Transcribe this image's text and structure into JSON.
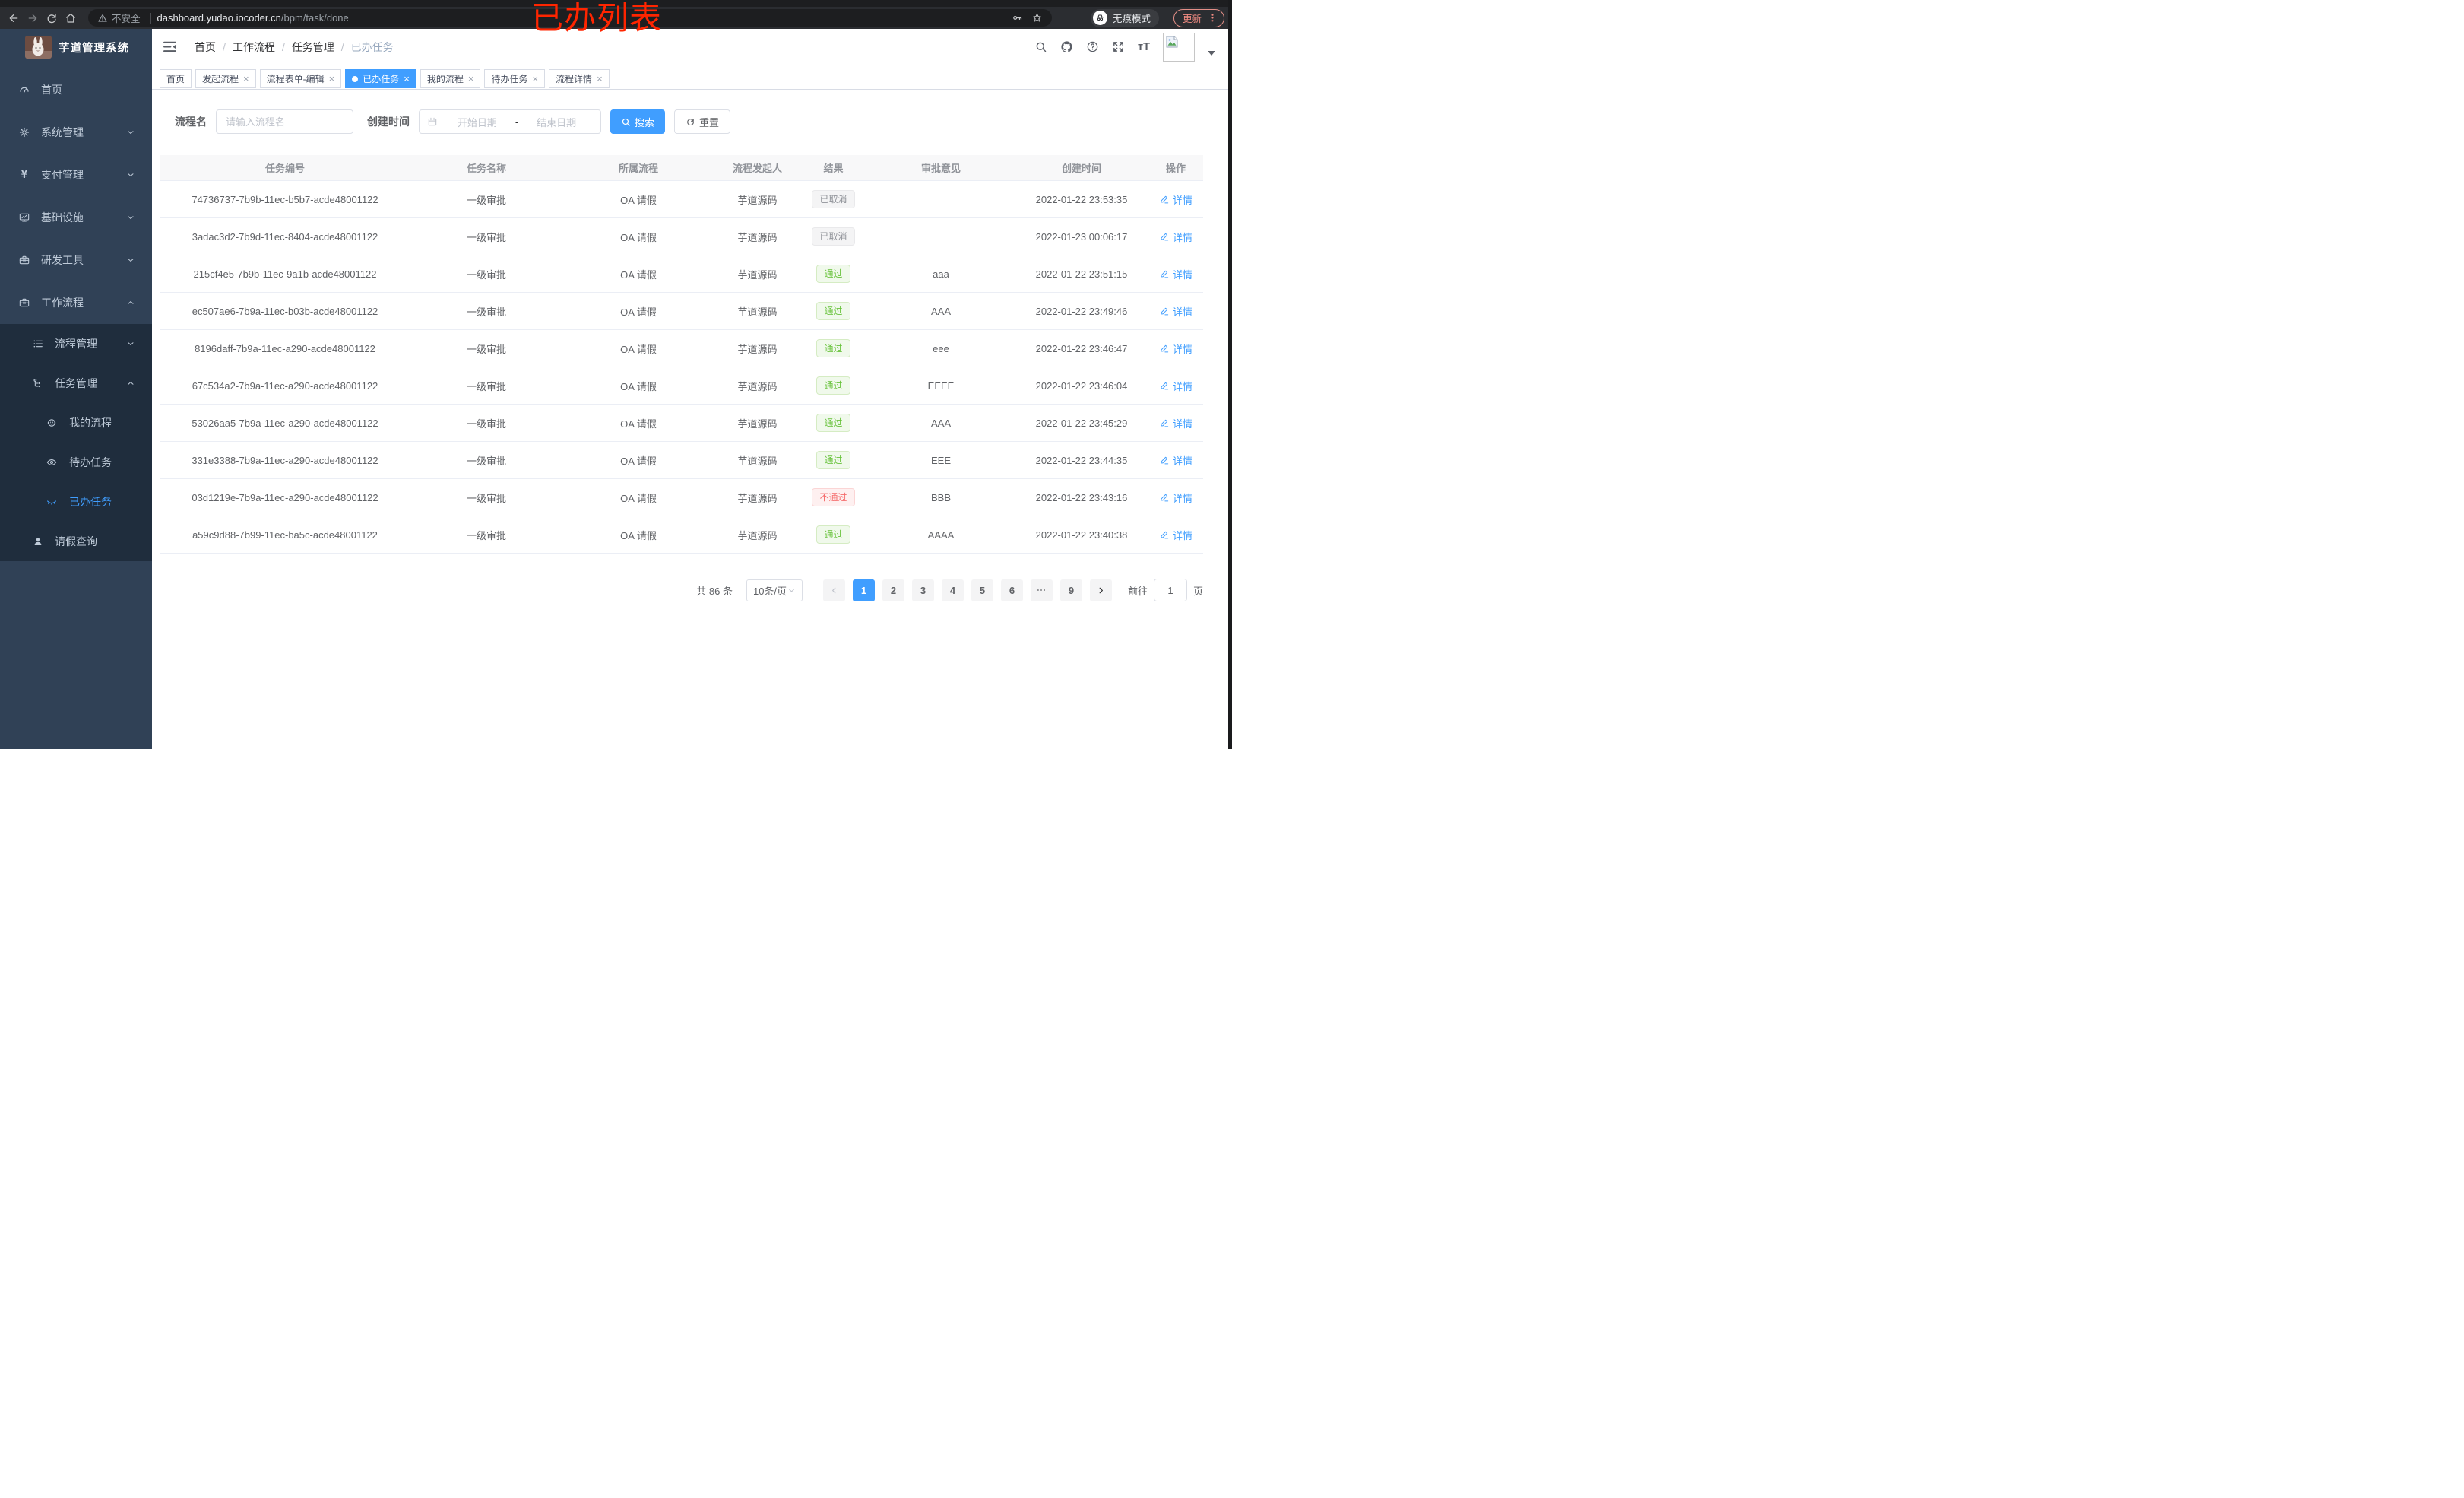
{
  "annotation": {
    "text": "已办列表",
    "color": "#ff2500"
  },
  "browser": {
    "security_label": "不安全",
    "url_domain": "dashboard.yudao.iocoder.cn",
    "url_path": "/bpm/task/done",
    "incognito_label": "无痕模式",
    "update_label": "更新"
  },
  "sidebar": {
    "logo_title": "芋道管理系统",
    "menu": [
      {
        "id": "home",
        "label": "首页",
        "icon": "dashboard-icon",
        "level": 1
      },
      {
        "id": "system",
        "label": "系统管理",
        "icon": "gear-icon",
        "level": 1,
        "arrow": "down"
      },
      {
        "id": "payment",
        "label": "支付管理",
        "icon": "yen-icon",
        "level": 1,
        "arrow": "down"
      },
      {
        "id": "infra",
        "label": "基础设施",
        "icon": "monitor-icon",
        "level": 1,
        "arrow": "down"
      },
      {
        "id": "devtools",
        "label": "研发工具",
        "icon": "toolbox-icon",
        "level": 1,
        "arrow": "down"
      },
      {
        "id": "workflow",
        "label": "工作流程",
        "icon": "briefcase-icon",
        "level": 1,
        "arrow": "up"
      },
      {
        "id": "process-mgmt",
        "label": "流程管理",
        "icon": "list-icon",
        "level": 2,
        "sub": true,
        "arrow": "down"
      },
      {
        "id": "task-mgmt",
        "label": "任务管理",
        "icon": "tree-icon",
        "level": 2,
        "sub": true,
        "arrow": "up"
      },
      {
        "id": "my-process",
        "label": "我的流程",
        "icon": "robot-icon",
        "level": 3,
        "sub": true
      },
      {
        "id": "todo-tasks",
        "label": "待办任务",
        "icon": "eye-open-icon",
        "level": 3,
        "sub": true
      },
      {
        "id": "done-tasks",
        "label": "已办任务",
        "icon": "eye-closed-icon",
        "level": 3,
        "sub": true,
        "active": true
      },
      {
        "id": "leave-query",
        "label": "请假查询",
        "icon": "user-icon",
        "level": 2,
        "sub": true
      }
    ]
  },
  "breadcrumb": {
    "items": [
      "首页",
      "工作流程",
      "任务管理",
      "已办任务"
    ]
  },
  "tabs": [
    {
      "id": "home",
      "label": "首页"
    },
    {
      "id": "start-process",
      "label": "发起流程",
      "closable": true
    },
    {
      "id": "form-editor",
      "label": "流程表单-编辑",
      "closable": true
    },
    {
      "id": "done-tasks",
      "label": "已办任务",
      "closable": true,
      "active": true
    },
    {
      "id": "my-process",
      "label": "我的流程",
      "closable": true
    },
    {
      "id": "todo-tasks",
      "label": "待办任务",
      "closable": true
    },
    {
      "id": "process-detail",
      "label": "流程详情",
      "closable": true
    }
  ],
  "filters": {
    "name_label": "流程名",
    "name_placeholder": "请输入流程名",
    "date_label": "创建时间",
    "date_start_placeholder": "开始日期",
    "date_separator": "-",
    "date_end_placeholder": "结束日期",
    "search_label": "搜索",
    "reset_label": "重置"
  },
  "table": {
    "columns": [
      "任务编号",
      "任务名称",
      "所属流程",
      "流程发起人",
      "结果",
      "审批意见",
      "创建时间",
      "操作"
    ],
    "action_label": "详情",
    "rows": [
      {
        "id": "74736737-7b9b-11ec-b5b7-acde48001122",
        "name": "一级审批",
        "process": "OA 请假",
        "starter": "芋道源码",
        "result": {
          "text": "已取消",
          "type": "info"
        },
        "comment": "",
        "created": "2022-01-22 23:53:35"
      },
      {
        "id": "3adac3d2-7b9d-11ec-8404-acde48001122",
        "name": "一级审批",
        "process": "OA 请假",
        "starter": "芋道源码",
        "result": {
          "text": "已取消",
          "type": "info"
        },
        "comment": "",
        "created": "2022-01-23 00:06:17"
      },
      {
        "id": "215cf4e5-7b9b-11ec-9a1b-acde48001122",
        "name": "一级审批",
        "process": "OA 请假",
        "starter": "芋道源码",
        "result": {
          "text": "通过",
          "type": "success"
        },
        "comment": "aaa",
        "created": "2022-01-22 23:51:15"
      },
      {
        "id": "ec507ae6-7b9a-11ec-b03b-acde48001122",
        "name": "一级审批",
        "process": "OA 请假",
        "starter": "芋道源码",
        "result": {
          "text": "通过",
          "type": "success"
        },
        "comment": "AAA",
        "created": "2022-01-22 23:49:46"
      },
      {
        "id": "8196daff-7b9a-11ec-a290-acde48001122",
        "name": "一级审批",
        "process": "OA 请假",
        "starter": "芋道源码",
        "result": {
          "text": "通过",
          "type": "success"
        },
        "comment": "eee",
        "created": "2022-01-22 23:46:47"
      },
      {
        "id": "67c534a2-7b9a-11ec-a290-acde48001122",
        "name": "一级审批",
        "process": "OA 请假",
        "starter": "芋道源码",
        "result": {
          "text": "通过",
          "type": "success"
        },
        "comment": "EEEE",
        "created": "2022-01-22 23:46:04"
      },
      {
        "id": "53026aa5-7b9a-11ec-a290-acde48001122",
        "name": "一级审批",
        "process": "OA 请假",
        "starter": "芋道源码",
        "result": {
          "text": "通过",
          "type": "success"
        },
        "comment": "AAA",
        "created": "2022-01-22 23:45:29"
      },
      {
        "id": "331e3388-7b9a-11ec-a290-acde48001122",
        "name": "一级审批",
        "process": "OA 请假",
        "starter": "芋道源码",
        "result": {
          "text": "通过",
          "type": "success"
        },
        "comment": "EEE",
        "created": "2022-01-22 23:44:35"
      },
      {
        "id": "03d1219e-7b9a-11ec-a290-acde48001122",
        "name": "一级审批",
        "process": "OA 请假",
        "starter": "芋道源码",
        "result": {
          "text": "不通过",
          "type": "danger"
        },
        "comment": "BBB",
        "created": "2022-01-22 23:43:16"
      },
      {
        "id": "a59c9d88-7b99-11ec-ba5c-acde48001122",
        "name": "一级审批",
        "process": "OA 请假",
        "starter": "芋道源码",
        "result": {
          "text": "通过",
          "type": "success"
        },
        "comment": "AAAA",
        "created": "2022-01-22 23:40:38"
      }
    ]
  },
  "pagination": {
    "total_label": "共 86 条",
    "page_size": "10条/页",
    "pages": [
      {
        "label": "1",
        "active": true
      },
      {
        "label": "2"
      },
      {
        "label": "3"
      },
      {
        "label": "4"
      },
      {
        "label": "5"
      },
      {
        "label": "6"
      },
      {
        "ellipsis": true
      },
      {
        "label": "9"
      }
    ],
    "goto_label": "前往",
    "goto_value": "1",
    "goto_suffix": "页"
  },
  "colors": {
    "accent": "#409eff",
    "success": "#67c23a",
    "danger": "#f56c6c",
    "info": "#909399",
    "sidebar_bg": "#304156",
    "submenu_bg": "#1f2d3d",
    "annotation_red": "#ff2500"
  }
}
